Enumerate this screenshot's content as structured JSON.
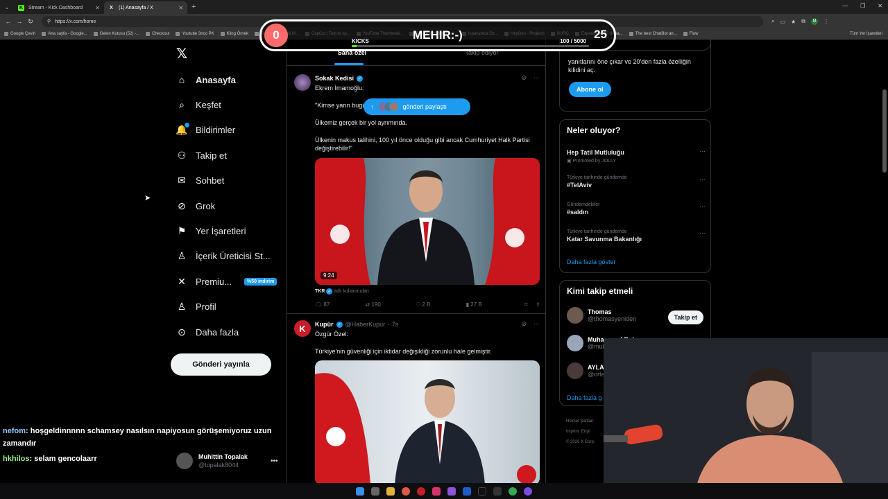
{
  "browser": {
    "tabs": [
      {
        "label": "Stream - Kick Dashboard",
        "icon": "K",
        "color": "#53fc18",
        "active": false
      },
      {
        "label": "(1) Anasayfa / X",
        "icon": "X",
        "color": "#ffffff",
        "active": true
      }
    ],
    "url": "https://x.com/home",
    "bookmarks": [
      "Google Çeviri",
      "Ana sayfa - Google...",
      "Gelen Kutusu (52) -...",
      "Checkout",
      "Youtube 3nco PK",
      "Kling Örnek",
      "Transcript of \"Mi M...",
      "CapCut | Text to sp...",
      "YouTube Thumbnail...",
      "Resize and reduce i...",
      "İspanyolca Öz...",
      "HeyGen - Projects",
      "BURÇ",
      "Esperanza000 Strea...",
      "The best ChatBot an...",
      "Flow"
    ],
    "bookmarks_end": "Tüm Yer İşaretleri",
    "profile_initial": "M"
  },
  "sidebar": {
    "logo": "𝕏",
    "items": [
      {
        "label": "Anasayfa",
        "icon": "home-icon",
        "bold": true
      },
      {
        "label": "Keşfet",
        "icon": "search-icon"
      },
      {
        "label": "Bildirimler",
        "icon": "bell-icon"
      },
      {
        "label": "Takip et",
        "icon": "person-add-icon"
      },
      {
        "label": "Sohbet",
        "icon": "mail-icon"
      },
      {
        "label": "Grok",
        "icon": "grok-icon"
      },
      {
        "label": "Yer İşaretleri",
        "icon": "bookmark-icon"
      },
      {
        "label": "İçerik Üreticisi St...",
        "icon": "creator-icon"
      },
      {
        "label": "Premiu...",
        "icon": "x-premium-icon",
        "badge": "%50 indirim"
      },
      {
        "label": "Profil",
        "icon": "person-icon"
      },
      {
        "label": "Daha fazla",
        "icon": "more-circle-icon"
      }
    ],
    "post_button": "Gönderi yayınla",
    "account": {
      "name": "Muhittin Topalak",
      "handle": "@topalak8044"
    }
  },
  "chat": [
    {
      "user": "nefom",
      "message": ": hoşgeldinnnnn schamsey nasılsın napiyosun görüşemiyoruz uzun zamandır"
    },
    {
      "user": "hkhilos",
      "message": ": selam gencolaarr"
    }
  ],
  "kick_goal": {
    "left_value": "0",
    "name": "MEHIR:-)",
    "right_value": "25",
    "label": "KICKS",
    "count": "100 / 5000",
    "progress": 0.02
  },
  "timeline": {
    "tabs": [
      "Sana özel",
      "Takip ediyor"
    ],
    "share_pill": "gönderi paylaştı",
    "tweets": [
      {
        "name": "Sokak Kedisi",
        "handle": "",
        "time": "",
        "lines": [
          "Ekrem İmamoğlu:",
          "\"Kimse yarın bugünden daha iyi olacak diyemiyor.",
          "Ülkemiz gerçek bir yol ayrımında.",
          "Ülkenin makus talihini, 100 yıl önce olduğu gibi ancak Cumhuriyet Halk Partisi değiştirebilir!\""
        ],
        "media_duration": "9:24",
        "source_name": "TKR",
        "source_text": "adlı kullanıcıdan",
        "stats": {
          "replies": "87",
          "reposts": "190",
          "likes": "2 B",
          "views": "27 B"
        }
      },
      {
        "name": "Kupür",
        "handle": "@HaberKupur",
        "time": "· 7s",
        "lines": [
          "Özgür Özel:",
          "Türkiye'nin güvenliği için iktidar değişikliği zorunlu hale gelmiştir."
        ]
      }
    ]
  },
  "right": {
    "premium": {
      "text": "yanıtlarını öne çıkar ve 20'den fazla özelliğin kilidini aç.",
      "button": "Abone ol"
    },
    "trends": {
      "title": "Neler oluyor?",
      "items": [
        {
          "meta": "",
          "title": "Hep Tatil Mutluluğu",
          "promo": "Promoted by JOLLY"
        },
        {
          "meta": "Türkiye tarihinde gündemde",
          "title": "#TelAviv"
        },
        {
          "meta": "Gündemdekiler",
          "title": "#saldırı"
        },
        {
          "meta": "Türkiye tarihinde gündemde",
          "title": "Katar Savunma Bakanlığı"
        }
      ],
      "show_more": "Daha fazla göster"
    },
    "who_to_follow": {
      "title": "Kimi takip etmeli",
      "users": [
        {
          "name": "Thomas",
          "handle": "@thomasyeniden",
          "button": "Takip et"
        },
        {
          "name": "Muhammed Bukur",
          "handle": "@mul"
        },
        {
          "name": "AYLA",
          "handle": "@orta"
        }
      ],
      "show_more": "Daha fazla g"
    },
    "footer": [
      "Hizmet Şartları",
      "Imprint",
      "Erişil",
      "© 2026 X Corp."
    ]
  }
}
